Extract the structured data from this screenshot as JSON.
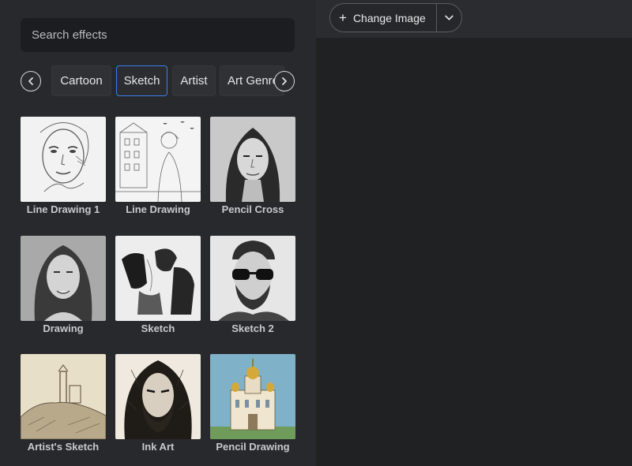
{
  "search": {
    "placeholder": "Search effects"
  },
  "categories": {
    "items": [
      "Cartoon",
      "Sketch",
      "Artist",
      "Art Genre"
    ],
    "active": "Sketch"
  },
  "effects": [
    {
      "label": "Line Drawing 1"
    },
    {
      "label": "Line Drawing"
    },
    {
      "label": "Pencil Cross"
    },
    {
      "label": "Drawing"
    },
    {
      "label": "Sketch"
    },
    {
      "label": "Sketch 2"
    },
    {
      "label": "Artist's Sketch"
    },
    {
      "label": "Ink Art"
    },
    {
      "label": "Pencil Drawing"
    }
  ],
  "toolbar": {
    "change_image_label": "Change Image"
  },
  "colors": {
    "accent": "#3d7ef0",
    "sidebar_bg": "#28292d",
    "canvas_bg": "#1f2123"
  },
  "icons": [
    "chevron-left-icon",
    "chevron-right-icon",
    "plus-icon",
    "chevron-down-icon"
  ]
}
